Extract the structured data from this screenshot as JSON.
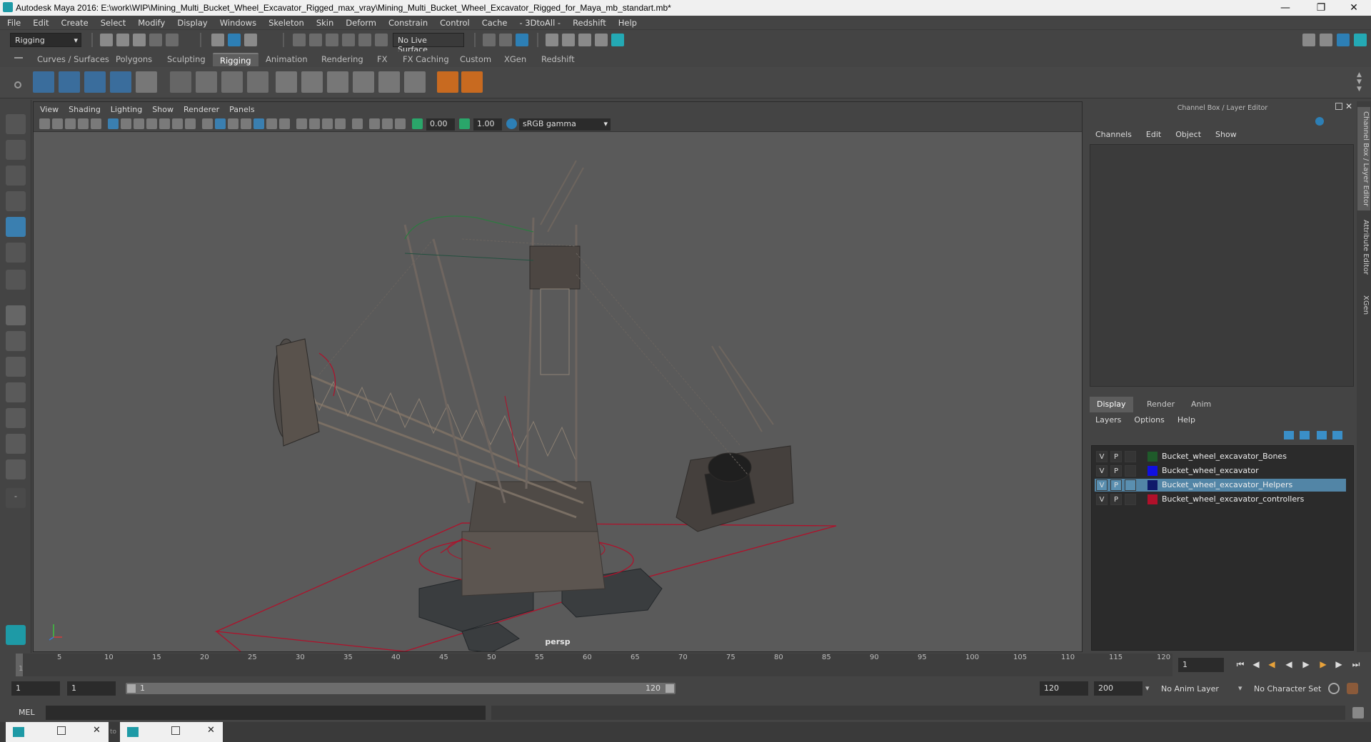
{
  "window": {
    "title": "Autodesk Maya 2016: E:\\work\\WIP\\Mining_Multi_Bucket_Wheel_Excavator_Rigged_max_vray\\Mining_Multi_Bucket_Wheel_Excavator_Rigged_for_Maya_mb_standart.mb*"
  },
  "menubar": [
    "File",
    "Edit",
    "Create",
    "Select",
    "Modify",
    "Display",
    "Windows",
    "Skeleton",
    "Skin",
    "Deform",
    "Constrain",
    "Control",
    "Cache",
    "- 3DtoAll -",
    "Redshift",
    "Help"
  ],
  "statusline": {
    "mode": "Rigging",
    "live_surface": "No Live Surface"
  },
  "shelf_tabs": [
    "Curves / Surfaces",
    "Polygons",
    "Sculpting",
    "Rigging",
    "Animation",
    "Rendering",
    "FX",
    "FX Caching",
    "Custom",
    "XGen",
    "Redshift"
  ],
  "shelf_active": "Rigging",
  "viewport": {
    "menu": [
      "View",
      "Shading",
      "Lighting",
      "Show",
      "Renderer",
      "Panels"
    ],
    "exposure": "0.00",
    "gamma": "1.00",
    "colorspace": "sRGB gamma",
    "camera": "persp"
  },
  "channelbox": {
    "title": "Channel Box / Layer Editor",
    "menu": [
      "Channels",
      "Edit",
      "Object",
      "Show"
    ],
    "layer_tabs": [
      "Display",
      "Render",
      "Anim"
    ],
    "layer_menu": [
      "Layers",
      "Options",
      "Help"
    ],
    "layers": [
      {
        "v": "V",
        "p": "P",
        "name": "Bucket_wheel_excavator_Bones",
        "color": "#1f5a2a",
        "selected": false
      },
      {
        "v": "V",
        "p": "P",
        "name": "Bucket_wheel_excavator",
        "color": "#1010e0",
        "selected": false
      },
      {
        "v": "V",
        "p": "P",
        "name": "Bucket_wheel_excavator_Helpers",
        "color": "#0f1a6a",
        "selected": true
      },
      {
        "v": "V",
        "p": "P",
        "name": "Bucket_wheel_excavator_controllers",
        "color": "#b0102a",
        "selected": false
      }
    ]
  },
  "side_tabs": [
    "Channel Box / Layer Editor",
    "Attribute Editor",
    "XGen"
  ],
  "timeline": {
    "ticks": [
      "1",
      "5",
      "10",
      "15",
      "20",
      "25",
      "30",
      "35",
      "40",
      "45",
      "50",
      "55",
      "60",
      "65",
      "70",
      "75",
      "80",
      "85",
      "90",
      "95",
      "100",
      "105",
      "110",
      "115",
      "120"
    ],
    "current_frame": "1"
  },
  "range": {
    "start": "1",
    "playback_start": "1",
    "slider_start": "1",
    "slider_end": "120",
    "playback_end": "120",
    "end": "200",
    "anim_layer": "No Anim Layer",
    "character_set": "No Character Set"
  },
  "cmdline": {
    "label": "MEL"
  },
  "taskbar": {
    "to_label": "to"
  },
  "colors": {
    "accent": "#5285a6",
    "bg": "#444444",
    "viewport": "#5a5a5a",
    "controller_red": "#b0102a"
  }
}
